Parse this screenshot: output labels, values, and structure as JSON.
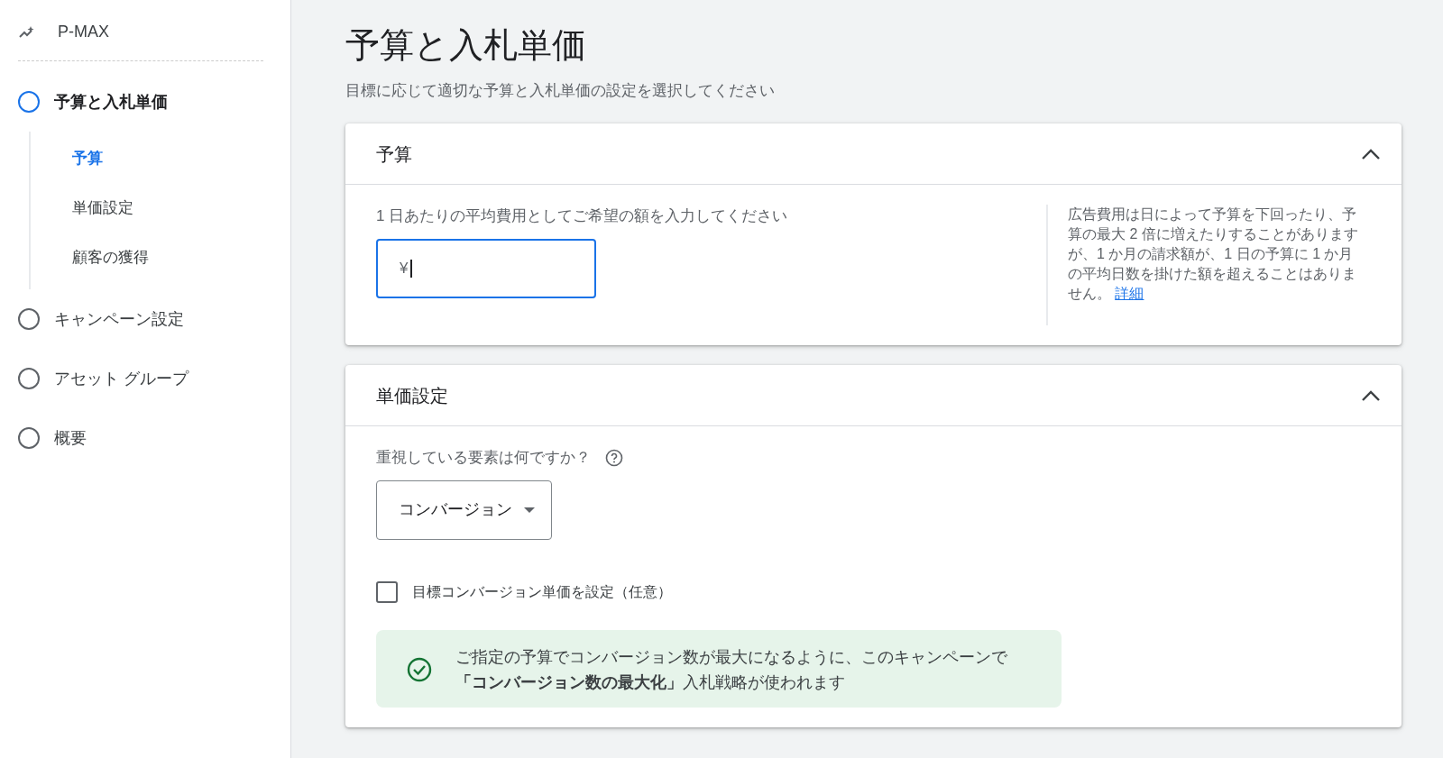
{
  "sidebar": {
    "campaign_type": "P-MAX",
    "steps": [
      {
        "label": "予算と入札単価",
        "selected": true,
        "children": [
          {
            "label": "予算",
            "selected": true
          },
          {
            "label": "単価設定",
            "selected": false
          },
          {
            "label": "顧客の獲得",
            "selected": false
          }
        ]
      },
      {
        "label": "キャンペーン設定",
        "selected": false
      },
      {
        "label": "アセット グループ",
        "selected": false
      },
      {
        "label": "概要",
        "selected": false
      }
    ]
  },
  "page": {
    "title": "予算と入札単価",
    "subtitle": "目標に応じて適切な予算と入札単価の設定を選択してください"
  },
  "sections": [
    {
      "kind": "budget",
      "title": "予算",
      "expanded": true,
      "prompt": "1 日あたりの平均費用としてご希望の額を入力してください",
      "field": {
        "prefix": "¥",
        "focused": true
      },
      "note": {
        "text": "広告費用は日によって予算を下回ったり、予算の最大 2 倍に増えたりすることがありますが、1 か月の請求額が、1 日の予算に 1 か月の平均日数を掛けた額を超えることはありません。",
        "link": "詳細"
      }
    },
    {
      "kind": "bidding",
      "title": "単価設定",
      "expanded": true,
      "question": "重視している要素は何ですか？",
      "dropdown": {
        "value": "コンバージョン"
      },
      "checkbox": {
        "label": "目標コンバージョン単価を設定（任意）",
        "checked": false
      },
      "info": "ご指定の予算でコンバージョン数が最大になるように、このキャンペーンで**「コンバージョン数の最大化」**入札戦略が使われます"
    }
  ]
}
